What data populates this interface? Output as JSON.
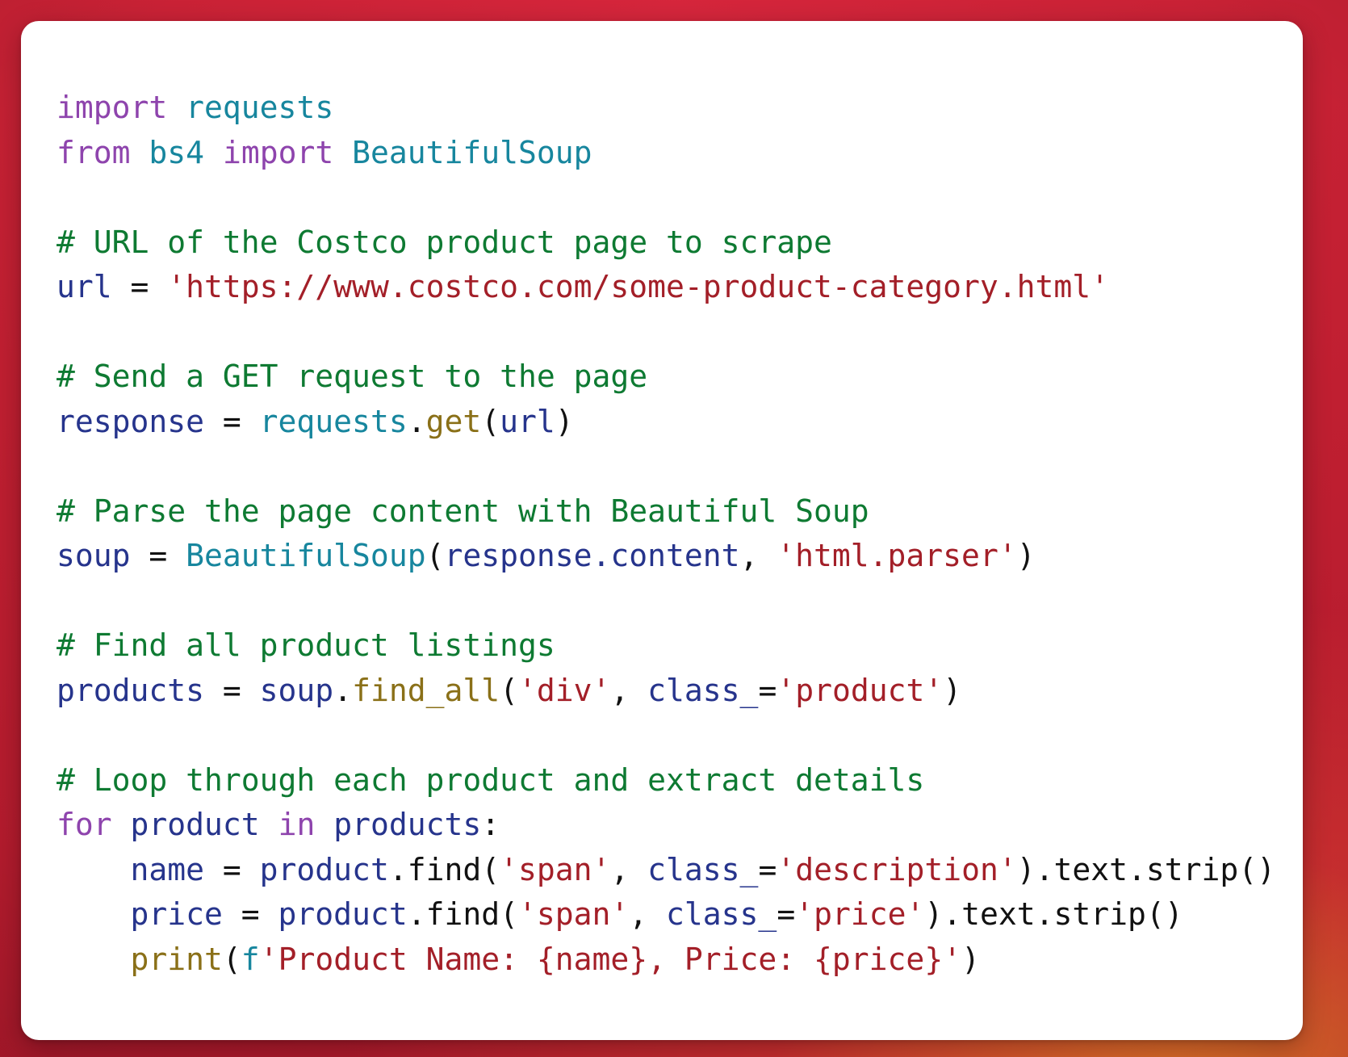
{
  "theme": {
    "background_color": "#c0202f",
    "card_color": "#ffffff",
    "keyword_color": "#8e44ad",
    "name_color": "#17869e",
    "comment_color": "#0e7a32",
    "string_color": "#a31f28",
    "variable_color": "#26348c",
    "function_color": "#8a7018",
    "operator_color": "#111111"
  },
  "code": {
    "language": "python",
    "lines": [
      {
        "id": "l1",
        "tokens": [
          {
            "t": "import",
            "c": "kw"
          },
          {
            "t": " ",
            "c": "op"
          },
          {
            "t": "requests",
            "c": "name"
          }
        ]
      },
      {
        "id": "l2",
        "tokens": [
          {
            "t": "from",
            "c": "kw"
          },
          {
            "t": " ",
            "c": "op"
          },
          {
            "t": "bs4",
            "c": "name"
          },
          {
            "t": " ",
            "c": "op"
          },
          {
            "t": "import",
            "c": "kw"
          },
          {
            "t": " ",
            "c": "op"
          },
          {
            "t": "BeautifulSoup",
            "c": "name"
          }
        ]
      },
      {
        "id": "l3",
        "tokens": []
      },
      {
        "id": "l4",
        "tokens": [
          {
            "t": "# URL of the Costco product page to scrape",
            "c": "com"
          }
        ]
      },
      {
        "id": "l5",
        "tokens": [
          {
            "t": "url",
            "c": "var"
          },
          {
            "t": " = ",
            "c": "op"
          },
          {
            "t": "'https://www.costco.com/some-product-category.html'",
            "c": "str"
          }
        ]
      },
      {
        "id": "l6",
        "tokens": []
      },
      {
        "id": "l7",
        "tokens": [
          {
            "t": "# Send a GET request to the page",
            "c": "com"
          }
        ]
      },
      {
        "id": "l8",
        "tokens": [
          {
            "t": "response",
            "c": "var"
          },
          {
            "t": " = ",
            "c": "op"
          },
          {
            "t": "requests",
            "c": "name"
          },
          {
            "t": ".",
            "c": "op"
          },
          {
            "t": "get",
            "c": "fn"
          },
          {
            "t": "(",
            "c": "op"
          },
          {
            "t": "url",
            "c": "var"
          },
          {
            "t": ")",
            "c": "op"
          }
        ]
      },
      {
        "id": "l9",
        "tokens": []
      },
      {
        "id": "l10",
        "tokens": [
          {
            "t": "# Parse the page content with Beautiful Soup",
            "c": "com"
          }
        ]
      },
      {
        "id": "l11",
        "tokens": [
          {
            "t": "soup",
            "c": "var"
          },
          {
            "t": " = ",
            "c": "op"
          },
          {
            "t": "BeautifulSoup",
            "c": "name"
          },
          {
            "t": "(",
            "c": "op"
          },
          {
            "t": "response.content",
            "c": "var"
          },
          {
            "t": ", ",
            "c": "op"
          },
          {
            "t": "'html.parser'",
            "c": "str"
          },
          {
            "t": ")",
            "c": "op"
          }
        ]
      },
      {
        "id": "l12",
        "tokens": []
      },
      {
        "id": "l13",
        "tokens": [
          {
            "t": "# Find all product listings",
            "c": "com"
          }
        ]
      },
      {
        "id": "l14",
        "tokens": [
          {
            "t": "products",
            "c": "var"
          },
          {
            "t": " = ",
            "c": "op"
          },
          {
            "t": "soup",
            "c": "var"
          },
          {
            "t": ".",
            "c": "op"
          },
          {
            "t": "find_all",
            "c": "fn"
          },
          {
            "t": "(",
            "c": "op"
          },
          {
            "t": "'div'",
            "c": "str"
          },
          {
            "t": ", ",
            "c": "op"
          },
          {
            "t": "class_",
            "c": "var"
          },
          {
            "t": "=",
            "c": "op"
          },
          {
            "t": "'product'",
            "c": "str"
          },
          {
            "t": ")",
            "c": "op"
          }
        ]
      },
      {
        "id": "l15",
        "tokens": []
      },
      {
        "id": "l16",
        "tokens": [
          {
            "t": "# Loop through each product and extract details",
            "c": "com"
          }
        ]
      },
      {
        "id": "l17",
        "tokens": [
          {
            "t": "for",
            "c": "kw"
          },
          {
            "t": " ",
            "c": "op"
          },
          {
            "t": "product",
            "c": "var"
          },
          {
            "t": " ",
            "c": "op"
          },
          {
            "t": "in",
            "c": "kw"
          },
          {
            "t": " ",
            "c": "op"
          },
          {
            "t": "products",
            "c": "var"
          },
          {
            "t": ":",
            "c": "op"
          }
        ]
      },
      {
        "id": "l18",
        "tokens": [
          {
            "t": "    ",
            "c": "op"
          },
          {
            "t": "name",
            "c": "var"
          },
          {
            "t": " = ",
            "c": "op"
          },
          {
            "t": "product",
            "c": "var"
          },
          {
            "t": ".",
            "c": "op"
          },
          {
            "t": "find",
            "c": "op"
          },
          {
            "t": "(",
            "c": "op"
          },
          {
            "t": "'span'",
            "c": "str"
          },
          {
            "t": ", ",
            "c": "op"
          },
          {
            "t": "class_",
            "c": "var"
          },
          {
            "t": "=",
            "c": "op"
          },
          {
            "t": "'description'",
            "c": "str"
          },
          {
            "t": ")",
            "c": "op"
          },
          {
            "t": ".text.strip",
            "c": "op"
          },
          {
            "t": "()",
            "c": "op"
          }
        ]
      },
      {
        "id": "l19",
        "tokens": [
          {
            "t": "    ",
            "c": "op"
          },
          {
            "t": "price",
            "c": "var"
          },
          {
            "t": " = ",
            "c": "op"
          },
          {
            "t": "product",
            "c": "var"
          },
          {
            "t": ".",
            "c": "op"
          },
          {
            "t": "find",
            "c": "op"
          },
          {
            "t": "(",
            "c": "op"
          },
          {
            "t": "'span'",
            "c": "str"
          },
          {
            "t": ", ",
            "c": "op"
          },
          {
            "t": "class_",
            "c": "var"
          },
          {
            "t": "=",
            "c": "op"
          },
          {
            "t": "'price'",
            "c": "str"
          },
          {
            "t": ")",
            "c": "op"
          },
          {
            "t": ".text.strip",
            "c": "op"
          },
          {
            "t": "()",
            "c": "op"
          }
        ]
      },
      {
        "id": "l20",
        "tokens": [
          {
            "t": "    ",
            "c": "op"
          },
          {
            "t": "print",
            "c": "fn"
          },
          {
            "t": "(",
            "c": "op"
          },
          {
            "t": "f",
            "c": "name"
          },
          {
            "t": "'Product Name: ",
            "c": "str"
          },
          {
            "t": "{name}",
            "c": "str"
          },
          {
            "t": ", Price: ",
            "c": "str"
          },
          {
            "t": "{price}",
            "c": "str"
          },
          {
            "t": "'",
            "c": "str"
          },
          {
            "t": ")",
            "c": "op"
          }
        ]
      }
    ],
    "plain_text": "import requests\nfrom bs4 import BeautifulSoup\n\n# URL of the Costco product page to scrape\nurl = 'https://www.costco.com/some-product-category.html'\n\n# Send a GET request to the page\nresponse = requests.get(url)\n\n# Parse the page content with Beautiful Soup\nsoup = BeautifulSoup(response.content, 'html.parser')\n\n# Find all product listings\nproducts = soup.find_all('div', class_='product')\n\n# Loop through each product and extract details\nfor product in products:\n    name = product.find('span', class_='description').text.strip()\n    price = product.find('span', class_='price').text.strip()\n    print(f'Product Name: {name}, Price: {price}')"
  }
}
